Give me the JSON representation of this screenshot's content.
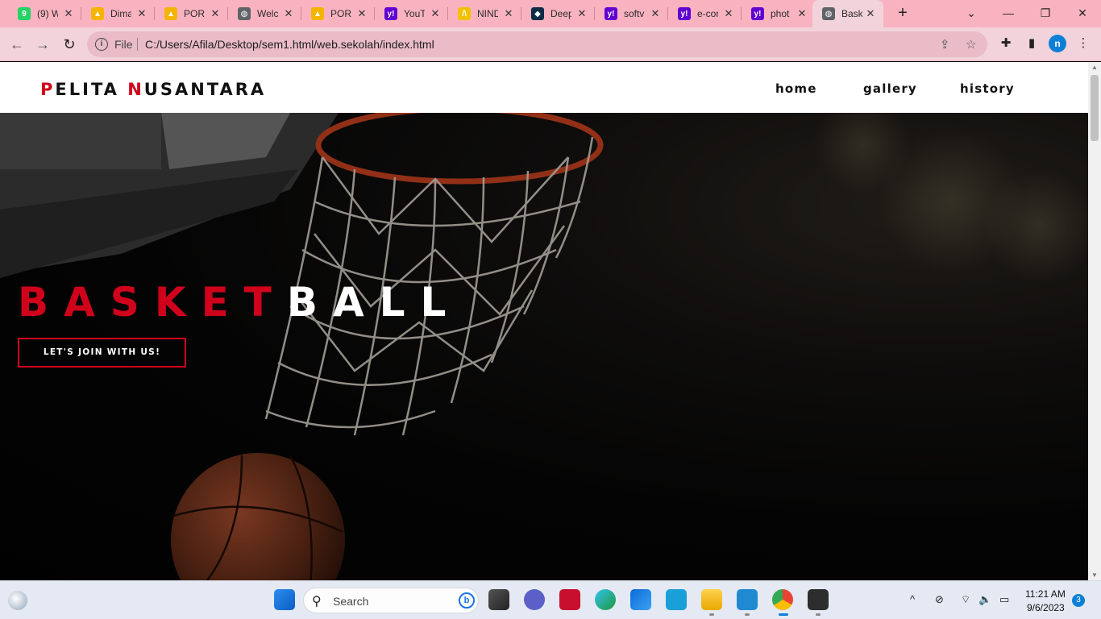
{
  "browser": {
    "tabs": [
      {
        "title": "(9) W",
        "icon": "whatsapp-icon",
        "color": "#25d366",
        "glyph": "9"
      },
      {
        "title": "Dima",
        "icon": "google-drive-icon",
        "color": "#f4b400",
        "glyph": "▲"
      },
      {
        "title": "PORT",
        "icon": "google-drive-icon",
        "color": "#f4b400",
        "glyph": "▲"
      },
      {
        "title": "Welc",
        "icon": "globe-icon",
        "color": "#5f6368",
        "glyph": "◍"
      },
      {
        "title": "PORT",
        "icon": "google-drive-icon",
        "color": "#f4b400",
        "glyph": "▲"
      },
      {
        "title": "YouT",
        "icon": "yahoo-icon",
        "color": "#6001d2",
        "glyph": "y!"
      },
      {
        "title": "NIND",
        "icon": "nindyanita-icon",
        "color": "#f2c200",
        "glyph": "/\\"
      },
      {
        "title": "Deep",
        "icon": "deepl-icon",
        "color": "#0f2b46",
        "glyph": "◆"
      },
      {
        "title": "softv",
        "icon": "yahoo-icon",
        "color": "#6001d2",
        "glyph": "y!"
      },
      {
        "title": "e-cor",
        "icon": "yahoo-icon",
        "color": "#6001d2",
        "glyph": "y!"
      },
      {
        "title": "phot",
        "icon": "yahoo-icon",
        "color": "#6001d2",
        "glyph": "y!"
      },
      {
        "title": "Bask",
        "icon": "globe-icon",
        "color": "#5f6368",
        "glyph": "◍",
        "active": true
      }
    ],
    "new_tab": "+",
    "controls": {
      "dropdown": "⌄",
      "minimize": "—",
      "restore": "❐",
      "close": "✕"
    },
    "nav": {
      "back": "←",
      "forward": "→",
      "reload": "↻"
    },
    "address": {
      "scheme_label": "File",
      "url": "C:/Users/Afila/Desktop/sem1.html/web.sekolah/index.html"
    },
    "toolbar_icons": {
      "share": "⇪",
      "bookmark": "☆",
      "extensions": "✚",
      "sidepanel": "▮",
      "menu": "⋮"
    },
    "profile_initial": "n"
  },
  "site": {
    "brand": {
      "first_initial": "P",
      "first_rest": "ELITA ",
      "second_initial": "N",
      "second_rest": "USANTARA"
    },
    "nav": [
      "home",
      "gallery",
      "history"
    ],
    "hero": {
      "title_red": "BASKET",
      "title_white": "BALL",
      "cta": "LET'S JOIN WITH US!"
    }
  },
  "taskbar": {
    "search_label": "Search",
    "clock_time": "11:21 AM",
    "clock_date": "9/6/2023",
    "notifications": "3",
    "tray": {
      "chevron": "^",
      "network": "⌔",
      "volume": "🔈",
      "battery": "▭"
    }
  },
  "colors": {
    "accent": "#d0021b",
    "tab_strip": "#f9b3c0",
    "toolbar": "#f3d3db"
  }
}
